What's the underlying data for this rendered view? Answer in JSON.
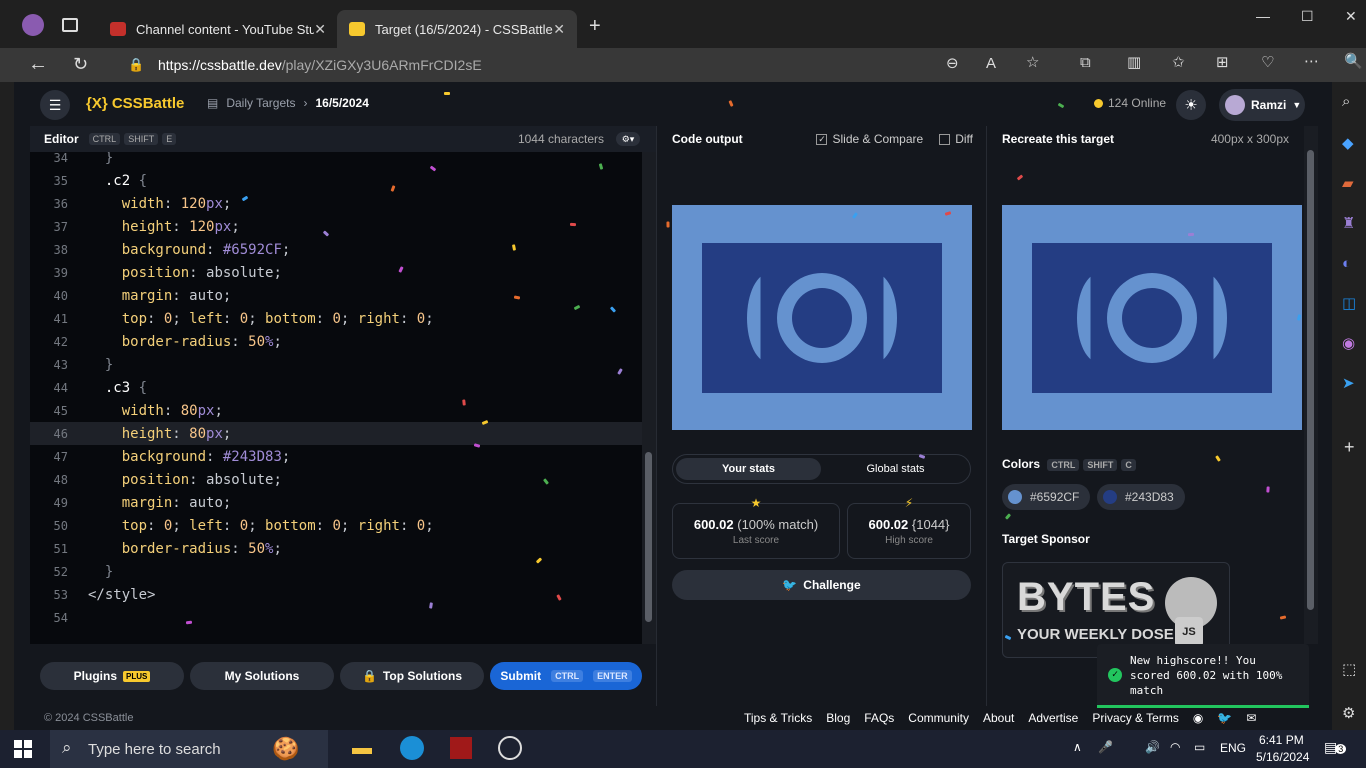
{
  "browser": {
    "tabs": [
      {
        "title": "Channel content - YouTube Studio",
        "active": false
      },
      {
        "title": "Target (16/5/2024) - CSSBattle",
        "active": true
      }
    ],
    "url_host": "https://cssbattle.dev",
    "url_path": "/play/XZiGXy3U6ARmFrCDI2sE"
  },
  "site": {
    "logo": "{X} CSSBattle",
    "breadcrumb_section": "Daily Targets",
    "breadcrumb_current": "16/5/2024",
    "online": "124 Online",
    "user": "Ramzi"
  },
  "editor": {
    "title": "Editor",
    "kbd": [
      "CTRL",
      "SHIFT",
      "E"
    ],
    "chars": "1044 characters",
    "lines": [
      {
        "n": "34",
        "t": "  }"
      },
      {
        "n": "35",
        "t": "  .c2 {"
      },
      {
        "n": "36",
        "t": "    width: 120px;"
      },
      {
        "n": "37",
        "t": "    height: 120px;"
      },
      {
        "n": "38",
        "t": "    background: #6592CF;"
      },
      {
        "n": "39",
        "t": "    position: absolute;"
      },
      {
        "n": "40",
        "t": "    margin: auto;"
      },
      {
        "n": "41",
        "t": "    top: 0; left: 0; bottom: 0; right: 0;"
      },
      {
        "n": "42",
        "t": "    border-radius: 50%;"
      },
      {
        "n": "43",
        "t": "  }"
      },
      {
        "n": "44",
        "t": "  .c3 {"
      },
      {
        "n": "45",
        "t": "    width: 80px;"
      },
      {
        "n": "46",
        "t": "    height: 80px;"
      },
      {
        "n": "47",
        "t": "    background: #243D83;"
      },
      {
        "n": "48",
        "t": "    position: absolute;"
      },
      {
        "n": "49",
        "t": "    margin: auto;"
      },
      {
        "n": "50",
        "t": "    top: 0; left: 0; bottom: 0; right: 0;"
      },
      {
        "n": "51",
        "t": "    border-radius: 50%;"
      },
      {
        "n": "52",
        "t": "  }"
      },
      {
        "n": "53",
        "t": "</style>"
      },
      {
        "n": "54",
        "t": ""
      }
    ],
    "highlight_line": "46"
  },
  "buttons": {
    "plugins": "Plugins",
    "plugins_badge": "PLUS",
    "solutions": "My Solutions",
    "top": "Top Solutions",
    "submit": "Submit",
    "submit_kbd": [
      "CTRL",
      "ENTER"
    ]
  },
  "output": {
    "title": "Code output",
    "slide": "Slide & Compare",
    "diff": "Diff",
    "tab_your": "Your stats",
    "tab_global": "Global stats",
    "last_score": "600.02",
    "last_match": "(100% match)",
    "last_label": "Last score",
    "high_score": "600.02",
    "high_chars": "{1044}",
    "high_label": "High score",
    "challenge": "Challenge"
  },
  "target": {
    "title": "Recreate this target",
    "size": "400px x 300px",
    "colors_label": "Colors",
    "colors_kbd": [
      "CTRL",
      "SHIFT",
      "C"
    ],
    "colors": [
      {
        "hex": "#6592CF",
        "label": "#6592CF"
      },
      {
        "hex": "#243D83",
        "label": "#243D83"
      }
    ],
    "sponsor_label": "Target Sponsor",
    "sponsor_big": "BYTES",
    "sponsor_small": "YOUR WEEKLY DOSE OF",
    "sponsor_js": "JS"
  },
  "footer": {
    "copyright": "© 2024 CSSBattle",
    "links": [
      "Tips & Tricks",
      "Blog",
      "FAQs",
      "Community",
      "About",
      "Advertise",
      "Privacy & Terms"
    ]
  },
  "toast": {
    "text": "New highscore!! You scored 600.02 with 100% match"
  },
  "taskbar": {
    "search": "Type here to search",
    "lang": "ENG",
    "time": "6:41 PM",
    "date": "5/16/2024",
    "notif": "3"
  },
  "colors": {
    "accent": "#f7c92e",
    "bg": "#14171d",
    "primary": "#1a66d6",
    "target_light": "#6592CF",
    "target_dark": "#243D83"
  }
}
